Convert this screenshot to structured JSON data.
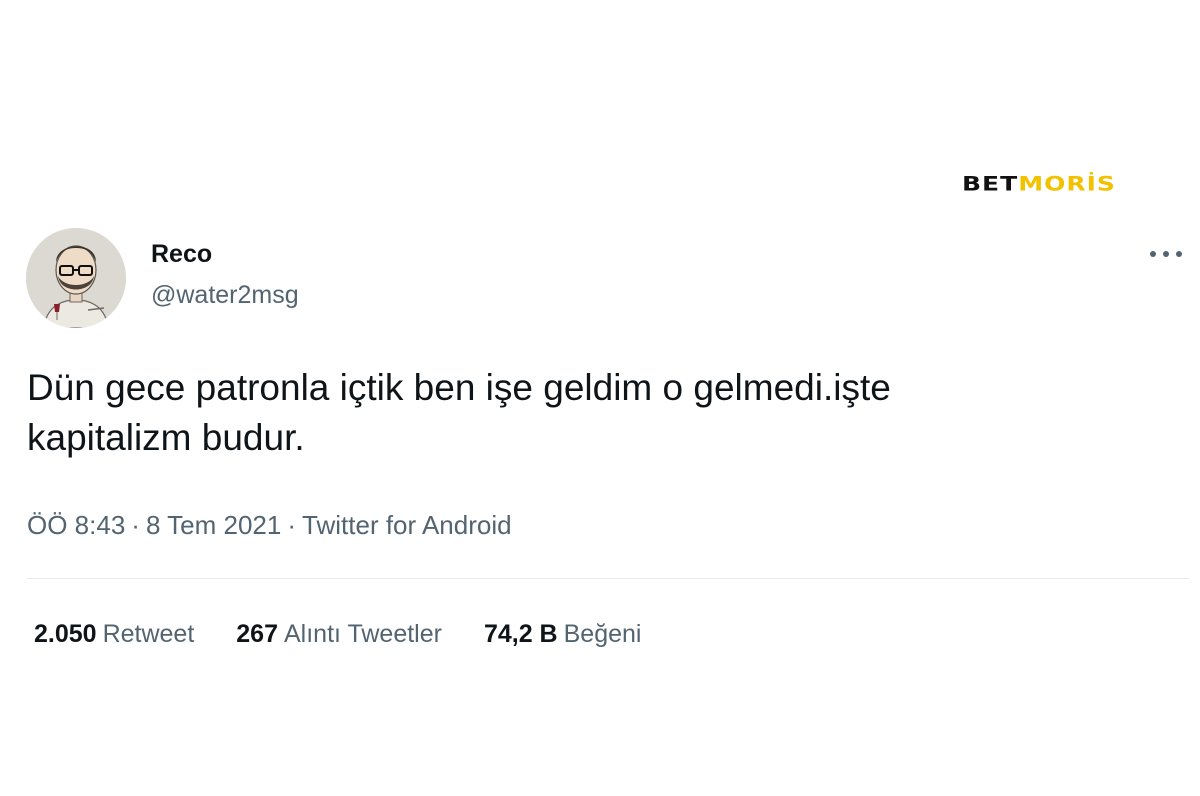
{
  "watermark": {
    "part1": "BET",
    "part2": "MORİS",
    "color_dark": "#111111",
    "color_accent": "#f2c200"
  },
  "tweet": {
    "author": {
      "name": "Reco",
      "handle": "@water2msg",
      "avatar_icon": "caricature-avatar"
    },
    "more_icon": "ellipsis-icon",
    "text_line1": "Dün gece patronla içtik ben işe geldim o gelmedi.işte",
    "text_line2": "kapitalizm budur.",
    "time": "ÖÖ 8:43",
    "separator": "·",
    "date": "8 Tem 2021",
    "source": "Twitter for Android",
    "stats": {
      "retweets_count": "2.050",
      "retweets_label": "Retweet",
      "quotes_count": "267",
      "quotes_label": "Alıntı Tweetler",
      "likes_count": "74,2 B",
      "likes_label": "Beğeni"
    }
  },
  "colors": {
    "text_primary": "#0f1419",
    "text_secondary": "#536471",
    "divider": "#e6ecf0"
  }
}
